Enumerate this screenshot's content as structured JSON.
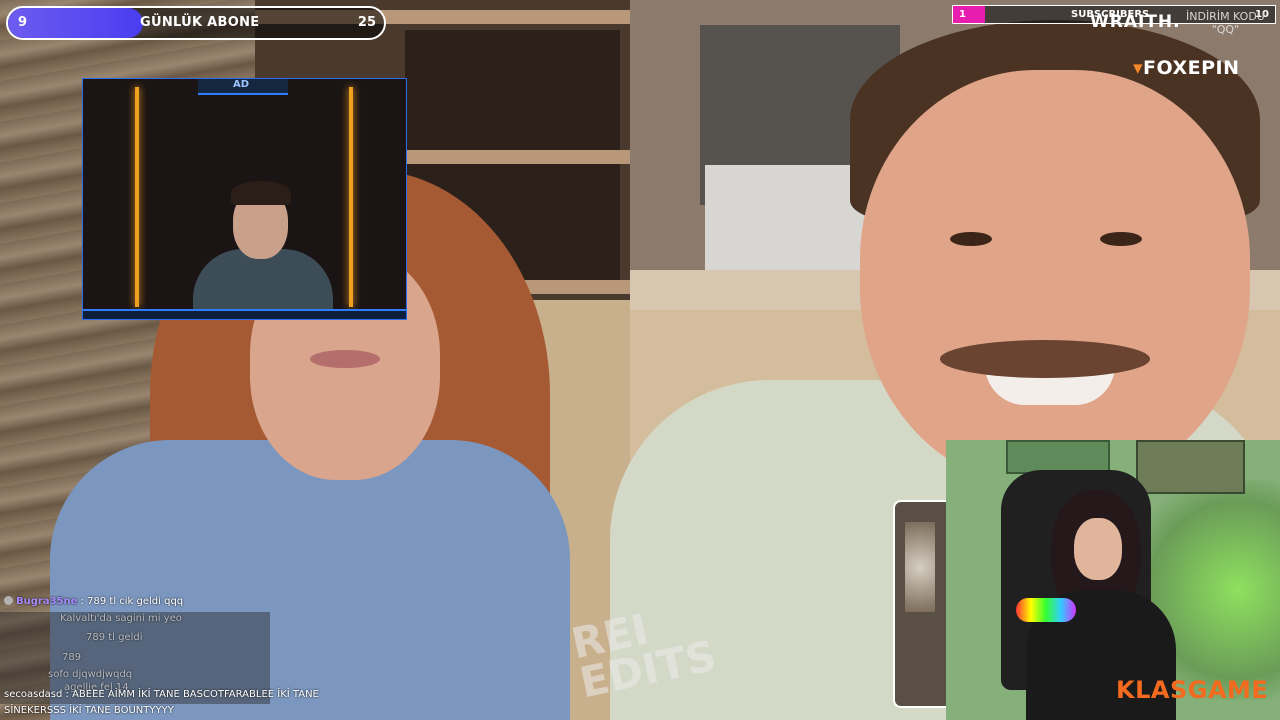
{
  "stream": {
    "daily_subs": {
      "label": "GÜNLÜK ABONE",
      "current": "9",
      "goal": "25",
      "progress": 0.36
    },
    "subscribers_bar": {
      "label": "SUBSCRIBERS",
      "current": "1",
      "goal": "10",
      "progress": 0.1
    },
    "sponsors": {
      "wraith": "WRAITH.",
      "discount_label": "İNDİRİM KODU",
      "discount_code": "\"QQ\"",
      "foxepin": "FOXEPIN",
      "klasgame": "KLASGAME"
    },
    "watermark": {
      "line1": "REI",
      "line2": "EDITS"
    },
    "webcam_logo": "AD",
    "colors": {
      "subs_fill": "#4a3df0",
      "subscribers_fill": "#e81cae",
      "foxepin_accent": "#f28a2a",
      "klasgame": "#f46a1e"
    }
  },
  "chat": {
    "messages": [
      {
        "user": "Bugra35ne",
        "text": ": 789 tl cik geldi qqq"
      },
      {
        "user": "",
        "text": "Kalvaltı'da sagini mi yeo"
      },
      {
        "user": "",
        "text": "789 tl geldi"
      },
      {
        "user": "",
        "text": ""
      },
      {
        "user": "",
        "text": "789"
      },
      {
        "user": "",
        "text": "sofo djqwdjwqdq"
      },
      {
        "user": "",
        "text": "agellie fel 14"
      }
    ],
    "last_user": "secoasdasd",
    "last_text": ": ABEEE AİMM İKİ TANE BASCOTFARABLEE İKİ TANE SİNEKERSSS İKİ TANE BOUNTYYYY"
  }
}
